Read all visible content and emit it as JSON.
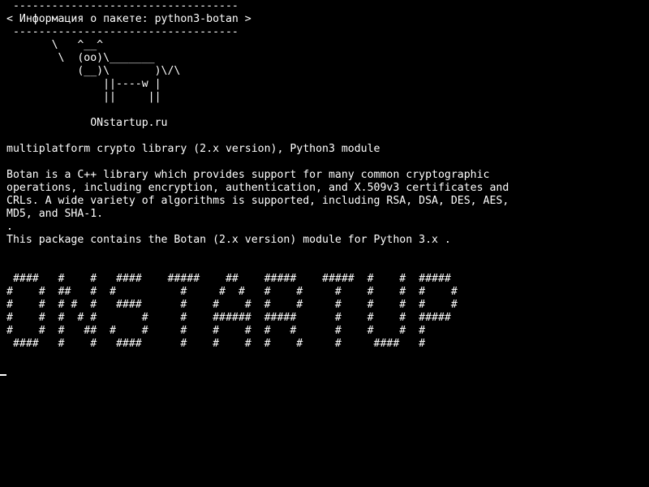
{
  "terminal": {
    "background": "#000000",
    "foreground": "#ffffff",
    "lines": [
      " -----------------------------------",
      "< Информация о пакете: python3-botan >",
      " -----------------------------------",
      "       \\   ^__^",
      "        \\  (oo)\\_______",
      "           (__)\\       )\\/\\",
      "               ||----w |",
      "               ||     ||",
      "",
      "             ONstartup.ru",
      "",
      "multiplatform crypto library (2.x version), Python3 module",
      "",
      "Botan is a C++ library which provides support for many common cryptographic",
      "operations, including encryption, authentication, and X.509v3 certificates and",
      "CRLs. A wide variety of algorithms is supported, including RSA, DSA, DES, AES,",
      "MD5, and SHA-1.",
      ".",
      "This package contains the Botan (2.x version) module for Python 3.x .",
      "",
      "",
      " ####   #    #   ####    #####    ##    #####    #####  #    #  #####",
      "#    #  ##   #  #          #     #  #   #    #     #    #    #  #    #",
      "#    #  # #  #   ####      #    #    #  #    #     #    #    #  #    #",
      "#    #  #  # #       #     #    ######  #####      #    #    #  #####",
      "#    #  #   ##  #    #     #    #    #  #   #      #    #    #  #",
      " ####   #    #   ####      #    #    #  #    #     #     ####   #"
    ],
    "cursor": "_"
  }
}
